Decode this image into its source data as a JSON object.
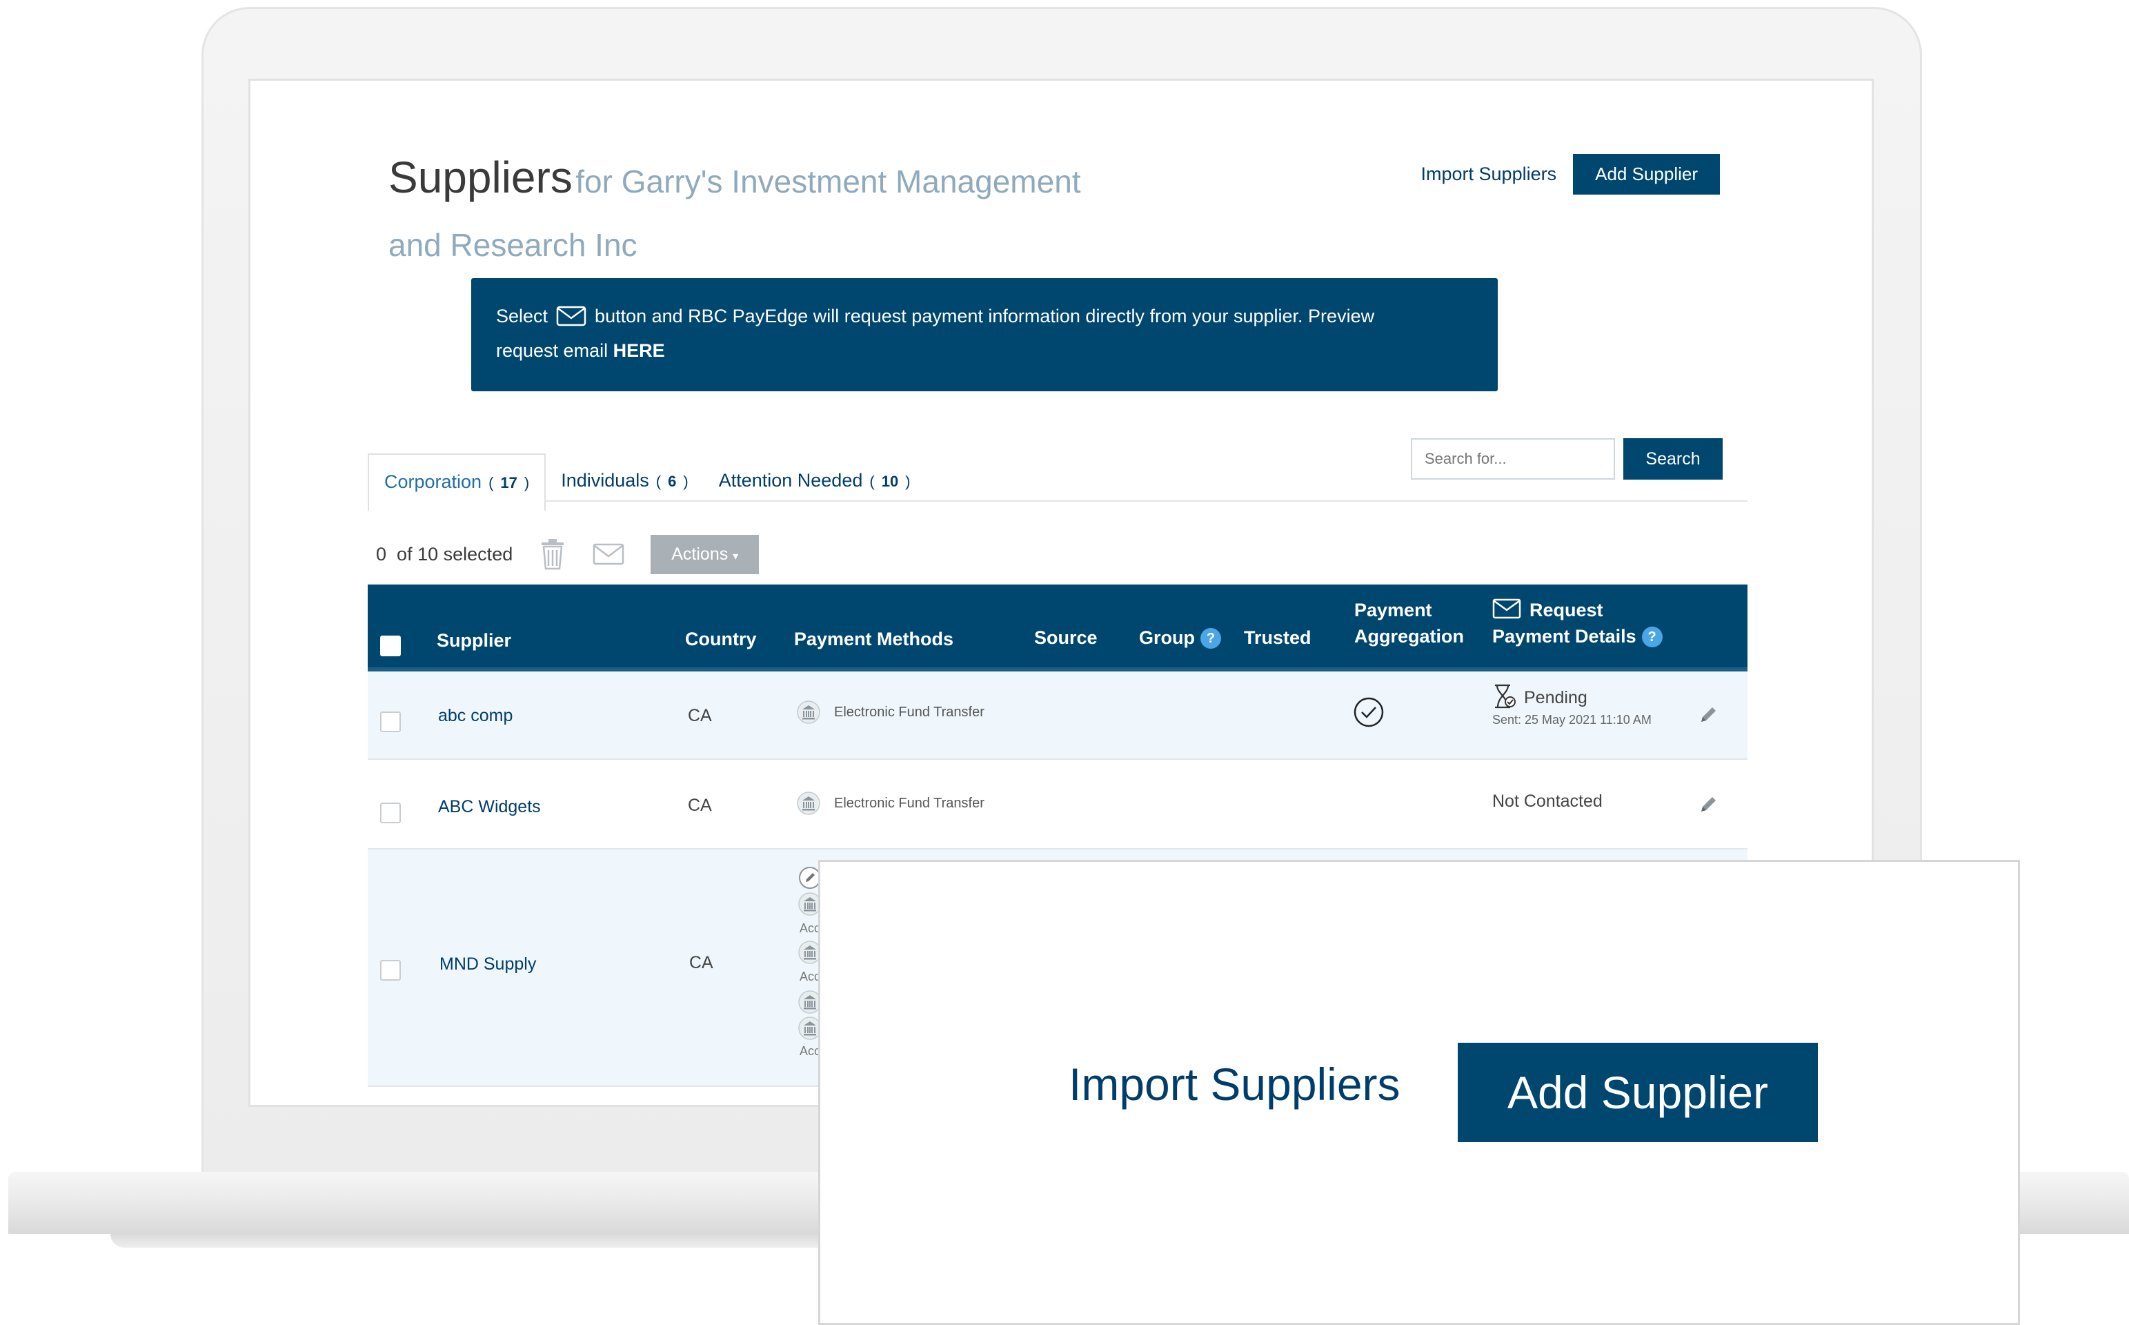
{
  "page": {
    "title": "Suppliers",
    "subtitle_line1": "for Garry's Investment Management",
    "subtitle_line2": "and Research Inc",
    "import_label": "Import Suppliers",
    "add_label": "Add Supplier"
  },
  "banner": {
    "part1": "Select",
    "part2": "button and RBC PayEdge will request payment information directly from your supplier. Preview",
    "part3": "request email",
    "link": "HERE"
  },
  "tabs": [
    {
      "label": "Corporation",
      "count": "17"
    },
    {
      "label": "Individuals",
      "count": "6"
    },
    {
      "label": "Attention Needed",
      "count": "10"
    }
  ],
  "search": {
    "placeholder": "Search for...",
    "button": "Search"
  },
  "selection": {
    "selected": "0",
    "of": "of",
    "total": "10",
    "suffix": "selected",
    "actions_label": "Actions"
  },
  "table": {
    "headers": {
      "supplier": "Supplier",
      "country": "Country",
      "payment_methods": "Payment Methods",
      "source": "Source",
      "group": "Group",
      "trusted": "Trusted",
      "aggregation_l1": "Payment",
      "aggregation_l2": "Aggregation",
      "request_l1": "Request",
      "request_l2": "Payment Details"
    },
    "rows": [
      {
        "supplier": "abc comp",
        "country": "CA",
        "method": "Electronic Fund Transfer",
        "status": "Pending",
        "sent": "Sent: 25 May 2021 11:10 AM"
      },
      {
        "supplier": "ABC Widgets",
        "country": "CA",
        "method": "Electronic Fund Transfer",
        "status": "Not Contacted"
      },
      {
        "supplier": "MND Supply",
        "country": "CA",
        "acc": "Acc"
      }
    ]
  },
  "zoom": {
    "import_label": "Import Suppliers",
    "add_label": "Add Supplier"
  },
  "colors": {
    "primary": "#00476f",
    "link": "#003d6b",
    "subtitle": "#8faabd",
    "row_alt": "#eff7fc",
    "help": "#4aa6e5"
  }
}
